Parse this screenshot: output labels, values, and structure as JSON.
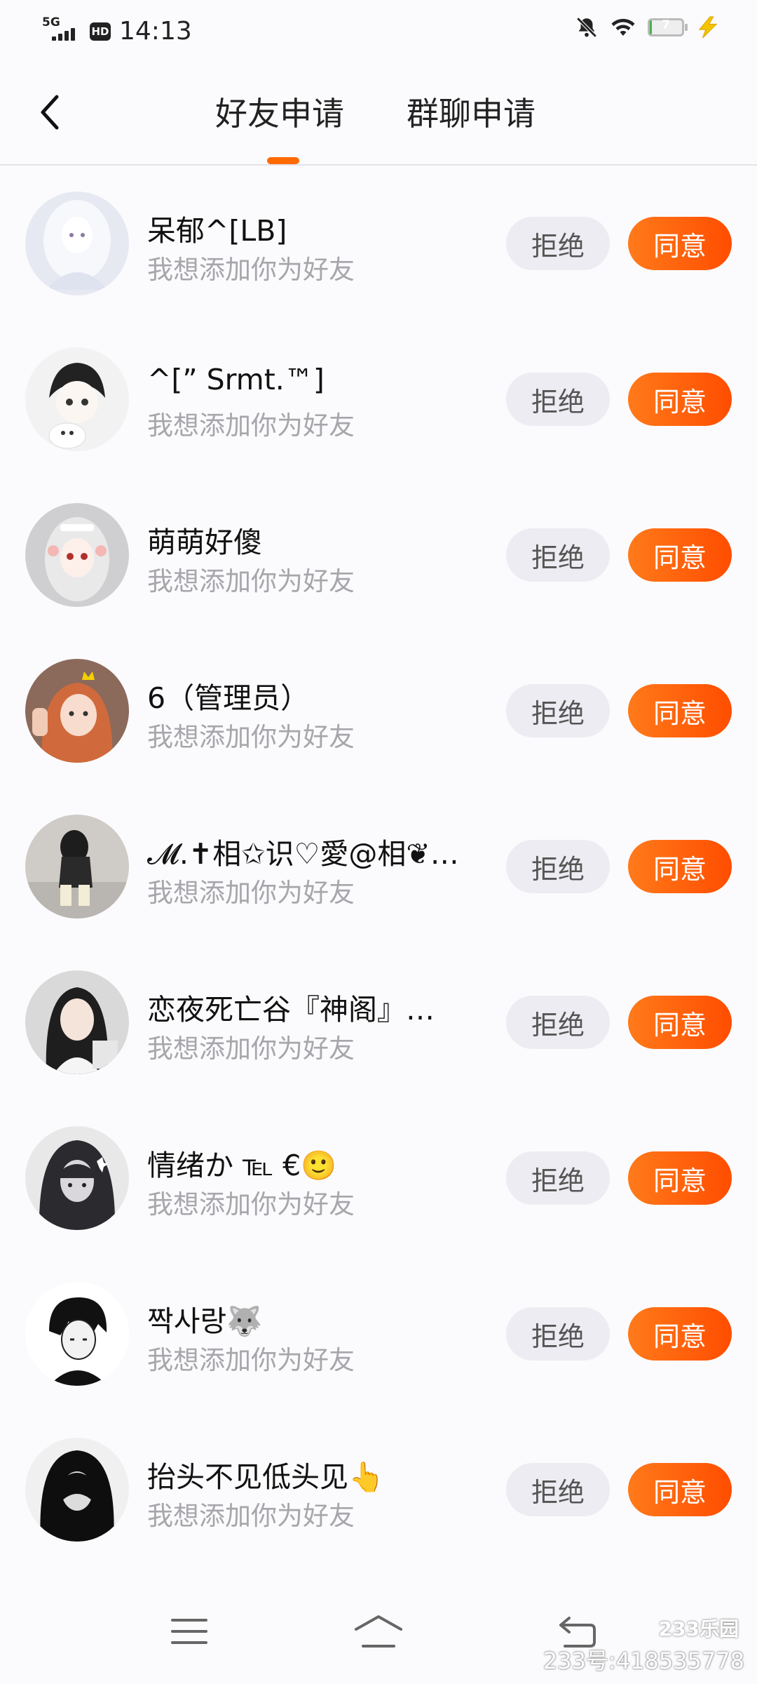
{
  "status_bar": {
    "network": "5G",
    "hd_badge": "HD",
    "time": "14:13",
    "battery_level": "7",
    "battery_fraction": 0.07,
    "icons": [
      "signal-icon",
      "hd-icon",
      "mute-bell-icon",
      "wifi-icon",
      "battery-icon",
      "charging-bolt-icon"
    ]
  },
  "header": {
    "back_icon": "chevron-left-icon",
    "tabs": [
      {
        "label": "好友申请",
        "active": true
      },
      {
        "label": "群聊申请",
        "active": false
      }
    ],
    "accent_color": "#ff6a00"
  },
  "requests": [
    {
      "name": "呆郁^[LB]",
      "message": "我想添加你为好友",
      "reject": "拒绝",
      "accept": "同意"
    },
    {
      "name": "^[” Srmt.™]",
      "message": "我想添加你为好友",
      "reject": "拒绝",
      "accept": "同意"
    },
    {
      "name": "萌萌好傻",
      "message": "我想添加你为好友",
      "reject": "拒绝",
      "accept": "同意"
    },
    {
      "name": "6（管理员）",
      "message": "我想添加你为好友",
      "reject": "拒绝",
      "accept": "同意"
    },
    {
      "name": "𝓜.✝相✩识♡愛@相❦…",
      "message": "我想添加你为好友",
      "reject": "拒绝",
      "accept": "同意"
    },
    {
      "name": "恋夜死亡谷『神阁』…",
      "message": "我想添加你为好友",
      "reject": "拒绝",
      "accept": "同意"
    },
    {
      "name": "情绪か ℡ €🙂",
      "message": "我想添加你为好友",
      "reject": "拒绝",
      "accept": "同意"
    },
    {
      "name": "짝사랑🐺",
      "message": "我想添加你为好友",
      "reject": "拒绝",
      "accept": "同意"
    },
    {
      "name": "抬头不见低头见👆",
      "message": "我想添加你为好友",
      "reject": "拒绝",
      "accept": "同意"
    }
  ],
  "nav_bar": {
    "items": [
      "menu-icon",
      "home-icon",
      "back-icon"
    ]
  },
  "watermark": {
    "logo": "233乐园",
    "id_text": "233号:418535778"
  },
  "colors": {
    "accept_start": "#ff7a1a",
    "accept_end": "#ff4d00",
    "reject_bg": "#ececf2",
    "subtext": "#a6a6ab"
  }
}
